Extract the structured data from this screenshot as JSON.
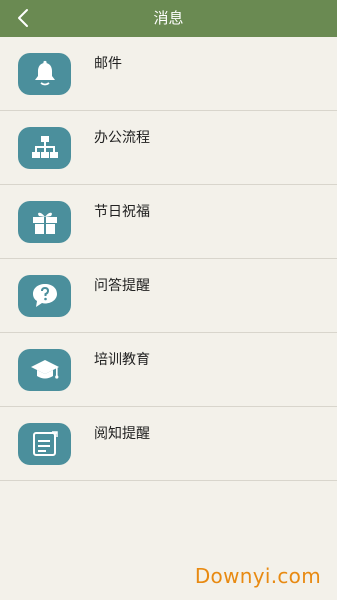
{
  "header": {
    "title": "消息",
    "back_icon": "chevron-left-icon",
    "background": "#6a8a52"
  },
  "items": [
    {
      "label": "邮件",
      "icon": "bell-icon"
    },
    {
      "label": "办公流程",
      "icon": "org-chart-icon"
    },
    {
      "label": "节日祝福",
      "icon": "gift-icon"
    },
    {
      "label": "问答提醒",
      "icon": "question-bubble-icon"
    },
    {
      "label": "培训教育",
      "icon": "graduation-cap-icon"
    },
    {
      "label": "阅知提醒",
      "icon": "document-edit-icon"
    }
  ],
  "accent_color": "#4b8f9c",
  "watermark": "Downyi.com"
}
